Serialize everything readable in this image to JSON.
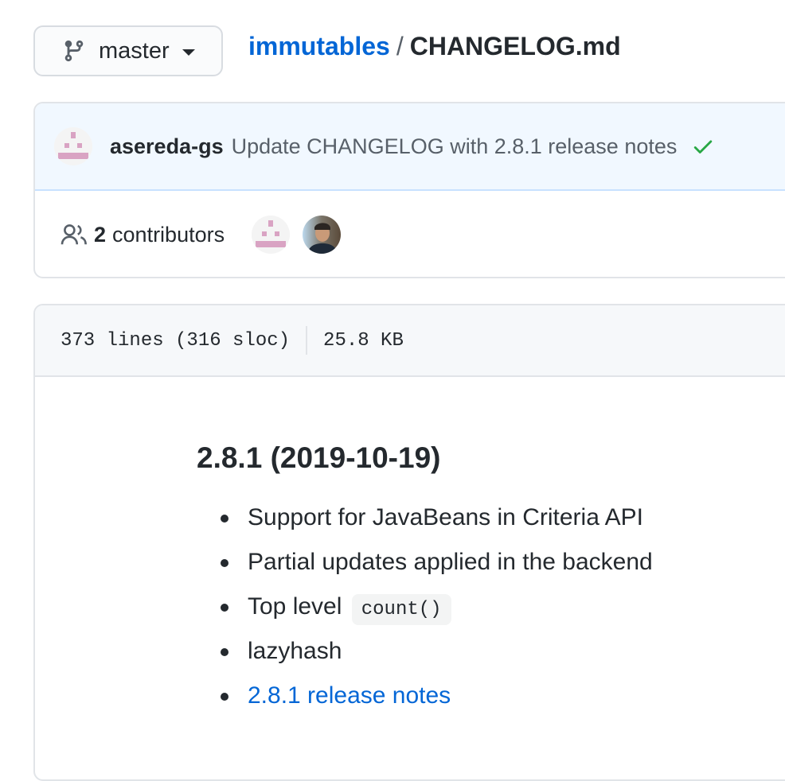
{
  "branch": {
    "label": "master",
    "icon": "git-branch-icon"
  },
  "breadcrumb": {
    "repo": "immutables",
    "separator": "/",
    "file": "CHANGELOG.md"
  },
  "commit": {
    "author": "asereda-gs",
    "message": "Update CHANGELOG with 2.8.1 release notes",
    "status_icon": "check-icon",
    "status_color": "#28a745"
  },
  "contributors": {
    "count": "2",
    "label": "contributors"
  },
  "file_info": {
    "lines": "373 lines (316 sloc)",
    "size": "25.8 KB"
  },
  "content": {
    "heading": "2.8.1 (2019-10-19)",
    "items": [
      {
        "text": "Support for JavaBeans in Criteria API"
      },
      {
        "text": "Partial updates applied in the backend"
      },
      {
        "text": "Top level",
        "code": "count()"
      },
      {
        "text": "lazyhash"
      },
      {
        "link": "2.8.1 release notes"
      }
    ]
  },
  "colors": {
    "link": "#0366d6",
    "text": "#24292e",
    "muted": "#586069",
    "commit_bg": "#f1f8ff"
  }
}
